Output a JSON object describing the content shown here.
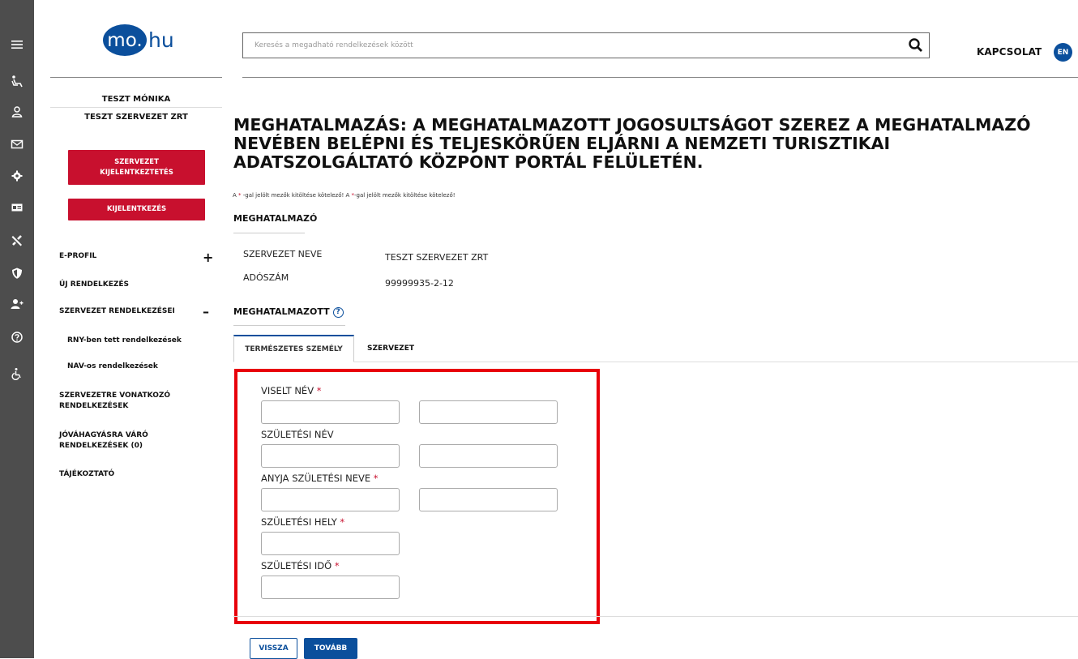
{
  "header": {
    "logo_mo": "mo.",
    "logo_hu": "hu",
    "search_placeholder": "Keresés a megadható rendelkezések között",
    "contact_label": "KAPCSOLAT",
    "lang_label": "EN"
  },
  "rail": {
    "icons": [
      "menu-icon",
      "chair-icon",
      "user-icon",
      "mail-icon",
      "gear-icon",
      "card-icon",
      "tools-icon",
      "shield-icon",
      "user-plus-icon",
      "help-icon",
      "accessibility-icon"
    ]
  },
  "sidebar": {
    "user_name": "TESZT MÓNIKA",
    "org_name": "TESZT SZERVEZET ZRT",
    "org_logout_label": "SZERVEZET KIJELENTKEZTETÉS",
    "logout_label": "KIJELENTKEZÉS",
    "items": [
      {
        "label": "E-PROFIL",
        "sign": "+"
      },
      {
        "label": "ÚJ RENDELKEZÉS"
      },
      {
        "label": "SZERVEZET RENDELKEZÉSEI",
        "sign": "–"
      },
      {
        "label": "RNY-ben tett rendelkezések"
      },
      {
        "label": "NAV-os rendelkezések"
      },
      {
        "label": "SZERVEZETRE VONATKOZÓ RENDELKEZÉSEK"
      },
      {
        "label": "JÓVÁHAGYÁSRA VÁRÓ RENDELKEZÉSEK (0)"
      },
      {
        "label": "TÁJÉKOZTATÓ"
      }
    ]
  },
  "main": {
    "title_line1": "MEGHATALMAZÁS: A MEGHATALMAZOTT JOGOSULTSÁGOT SZEREZ A MEGHATALMAZÓ",
    "title_line2": "NEVÉBEN BELÉPNI ÉS TELJESKÖRŰEN ELJÁRNI A NEMZETI TURISZTIKAI",
    "title_line3": "ADATSZOLGÁLTATÓ KÖZPONT PORTÁL FELÜLETÉN.",
    "required_note_a": "A ",
    "required_note_star": "*",
    "required_note_b": " -gal jelölt mezők kitöltése kötelező! A ",
    "required_note_star2": "*",
    "required_note_c": "-gal jelölt mezők kitöltése kötelező!",
    "principal_heading": "MEGHATALMAZÓ",
    "org_name_label": "SZERVEZET NEVE",
    "org_name_value": "TESZT SZERVEZET ZRT",
    "tax_label": "ADÓSZÁM",
    "tax_value": "99999935-2-12",
    "agent_heading": "MEGHATALMAZOTT",
    "help_glyph": "?",
    "tabs": [
      {
        "label": "TERMÉSZETES SZEMÉLY"
      },
      {
        "label": "SZERVEZET"
      }
    ],
    "fields": {
      "viselt_nev": "VISELT NÉV",
      "szuletesi_nev": "SZÜLETÉSI NÉV",
      "anyja_nev": "ANYJA SZÜLETÉSI NEVE",
      "szuletesi_hely": "SZÜLETÉSI HELY",
      "szuletesi_ido": "SZÜLETÉSI IDŐ",
      "required_star": "*"
    },
    "back_label": "VISSZA",
    "next_label": "TOVÁBB"
  }
}
